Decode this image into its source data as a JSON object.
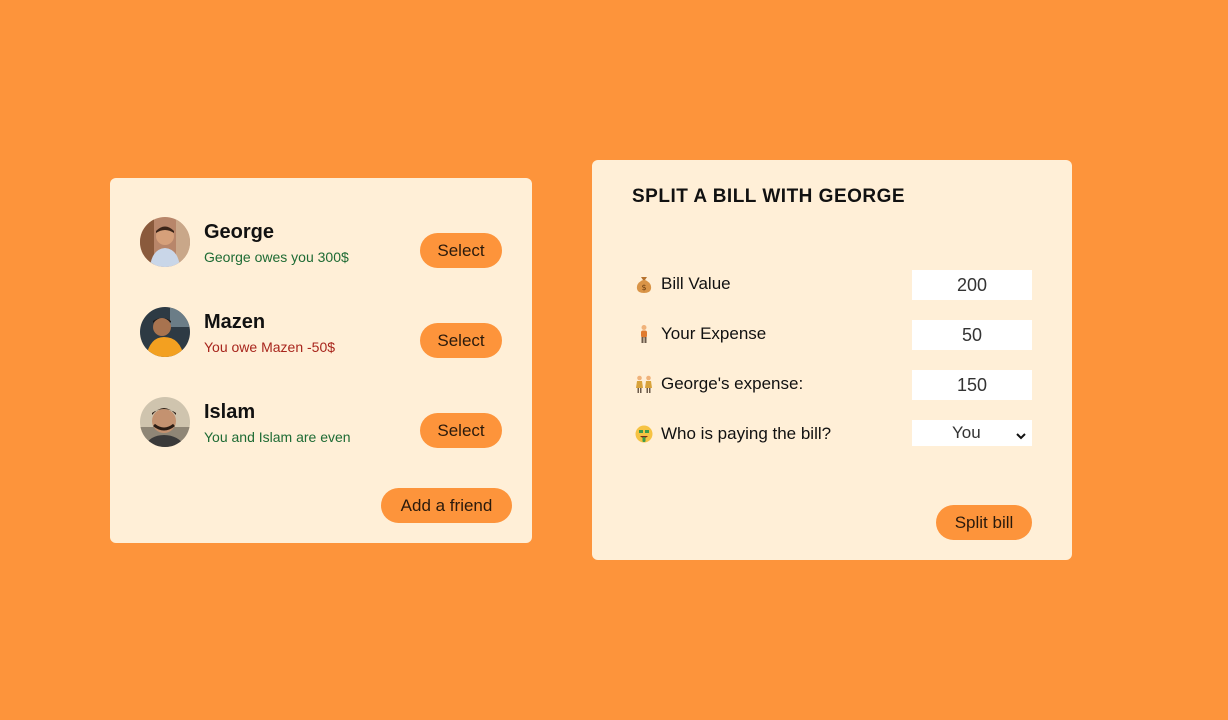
{
  "friends": [
    {
      "name": "George",
      "status": "George owes you 300$",
      "status_color": "#1e6b34",
      "button": "Select"
    },
    {
      "name": "Mazen",
      "status": "You owe Mazen -50$",
      "status_color": "#a8251c",
      "button": "Select"
    },
    {
      "name": "Islam",
      "status": "You and Islam are even",
      "status_color": "#1e6b34",
      "button": "Select"
    }
  ],
  "add_friend_label": "Add a friend",
  "split": {
    "title": "SPLIT A BILL WITH GEORGE",
    "rows": [
      {
        "icon": "money-bag-icon",
        "label": "Bill Value",
        "value": "200"
      },
      {
        "icon": "person-icon",
        "label": "Your Expense",
        "value": "50"
      },
      {
        "icon": "people-icon",
        "label": "George's expense:",
        "value": "150"
      },
      {
        "icon": "money-face-icon",
        "label": "Who is paying the bill?",
        "selected": "You"
      }
    ],
    "button": "Split bill"
  },
  "colors": {
    "background": "#fd943b",
    "card": "#ffefd7",
    "accent": "#fd943b"
  }
}
